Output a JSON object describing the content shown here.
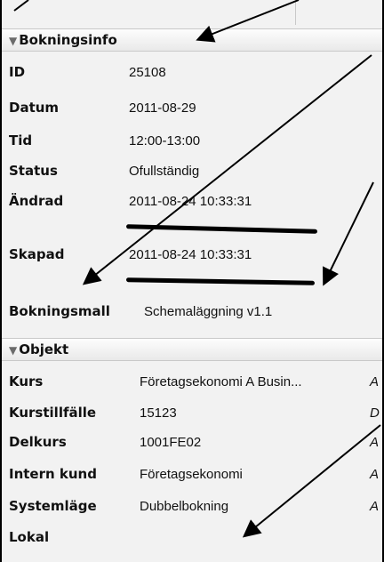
{
  "booking": {
    "header": "Bokningsinfo",
    "id_label": "ID",
    "id_value": "25108",
    "date_label": "Datum",
    "date_value": "2011-08-29",
    "time_label": "Tid",
    "time_value": "12:00-13:00",
    "status_label": "Status",
    "status_value": "Ofullständig",
    "changed_label": "Ändrad",
    "changed_value": "2011-08-24 10:33:31",
    "created_label": "Skapad",
    "created_value": "2011-08-24 10:33:31",
    "template_label": "Bokningsmall",
    "template_value": "Schemaläggning v1.1"
  },
  "objects": {
    "header": "Objekt",
    "rows": [
      {
        "label": "Kurs",
        "value": "Företagsekonomi A Busin...",
        "extra": "A"
      },
      {
        "label": "Kurstillfälle",
        "value": "15123",
        "extra": "D"
      },
      {
        "label": "Delkurs",
        "value": "1001FE02",
        "extra": "A"
      },
      {
        "label": "Intern kund",
        "value": "Företagsekonomi",
        "extra": "A"
      },
      {
        "label": "Systemläge",
        "value": "Dubbelbokning",
        "extra": "A"
      },
      {
        "label": "Lokal",
        "value": "",
        "extra": ""
      }
    ]
  },
  "colors": {
    "panel_bg": "#f2f2f2",
    "header_bg": "#ececec",
    "frame": "#000000",
    "arrows": "#000000"
  }
}
